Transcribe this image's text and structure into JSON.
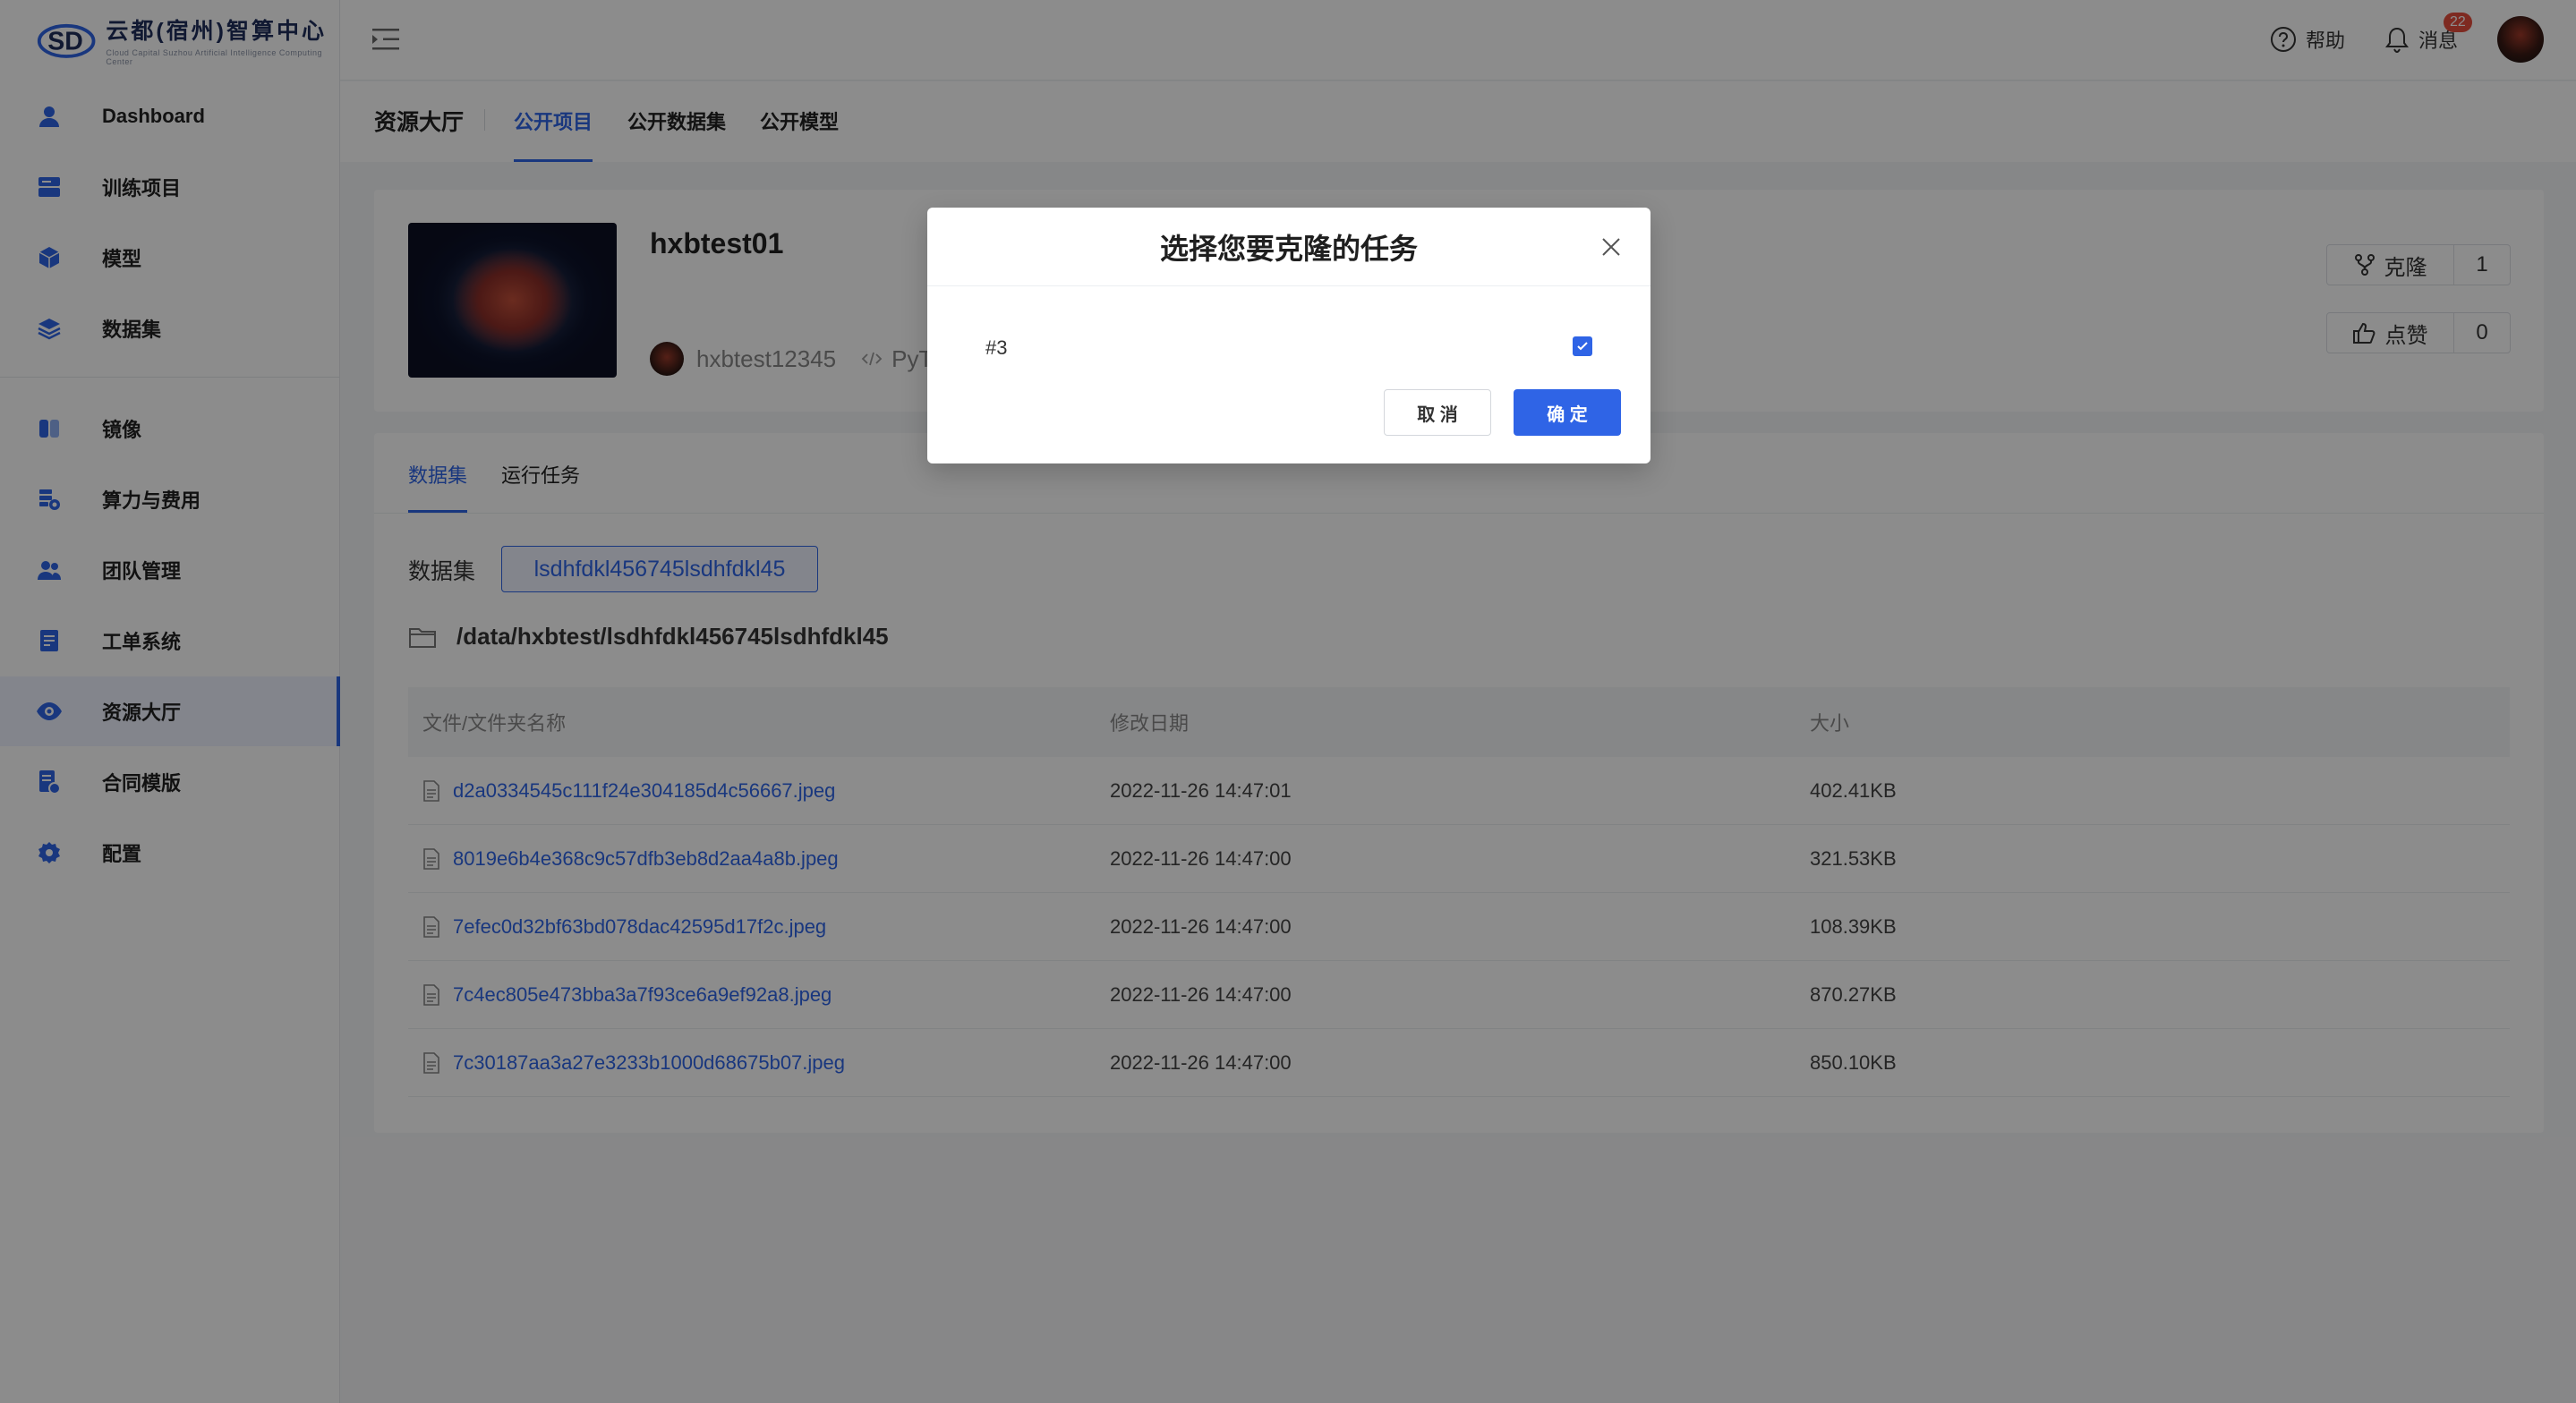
{
  "brand": {
    "title": "云都(宿州)智算中心",
    "subtitle": "Cloud Capital Suzhou Artificial Intelligence Computing Center"
  },
  "sidebar": {
    "items": [
      {
        "label": "Dashboard",
        "icon": "user-icon"
      },
      {
        "label": "训练项目",
        "icon": "project-icon"
      },
      {
        "label": "模型",
        "icon": "cube-icon"
      },
      {
        "label": "数据集",
        "icon": "layers-icon"
      },
      {
        "label": "镜像",
        "icon": "image-icon"
      },
      {
        "label": "算力与费用",
        "icon": "billing-icon"
      },
      {
        "label": "团队管理",
        "icon": "team-icon"
      },
      {
        "label": "工单系统",
        "icon": "ticket-icon"
      },
      {
        "label": "资源大厅",
        "icon": "eye-icon",
        "active": true
      },
      {
        "label": "合同模版",
        "icon": "contract-icon"
      },
      {
        "label": "配置",
        "icon": "gear-icon"
      }
    ]
  },
  "header": {
    "help_label": "帮助",
    "messages_label": "消息",
    "messages_count": "22"
  },
  "subnav": {
    "title": "资源大厅",
    "tabs": [
      "公开项目",
      "公开数据集",
      "公开模型"
    ],
    "active_index": 0
  },
  "project": {
    "name": "hxbtest01",
    "owner": "hxbtest12345",
    "language": "PyT",
    "clone_label": "克隆",
    "clone_count": "1",
    "like_label": "点赞",
    "like_count": "0"
  },
  "data_section": {
    "tabs": [
      "数据集",
      "运行任务"
    ],
    "dataset_label": "数据集",
    "dataset_name": "lsdhfdkl456745lsdhfdkl45",
    "path": "/data/hxbtest/lsdhfdkl456745lsdhfdkl45",
    "columns": [
      "文件/文件夹名称",
      "修改日期",
      "大小"
    ],
    "rows": [
      {
        "name": "d2a0334545c111f24e304185d4c56667.jpeg",
        "date": "2022-11-26 14:47:01",
        "size": "402.41KB"
      },
      {
        "name": "8019e6b4e368c9c57dfb3eb8d2aa4a8b.jpeg",
        "date": "2022-11-26 14:47:00",
        "size": "321.53KB"
      },
      {
        "name": "7efec0d32bf63bd078dac42595d17f2c.jpeg",
        "date": "2022-11-26 14:47:00",
        "size": "108.39KB"
      },
      {
        "name": "7c4ec805e473bba3a7f93ce6a9ef92a8.jpeg",
        "date": "2022-11-26 14:47:00",
        "size": "870.27KB"
      },
      {
        "name": "7c30187aa3a27e3233b1000d68675b07.jpeg",
        "date": "2022-11-26 14:47:00",
        "size": "850.10KB"
      }
    ]
  },
  "modal": {
    "title": "选择您要克隆的任务",
    "option_label": "#3",
    "option_checked": true,
    "cancel_label": "取 消",
    "ok_label": "确 定"
  },
  "colors": {
    "accent": "#2f64e6",
    "badge": "#e64d3d",
    "overlay": "rgba(0,0,0,0.45)"
  }
}
